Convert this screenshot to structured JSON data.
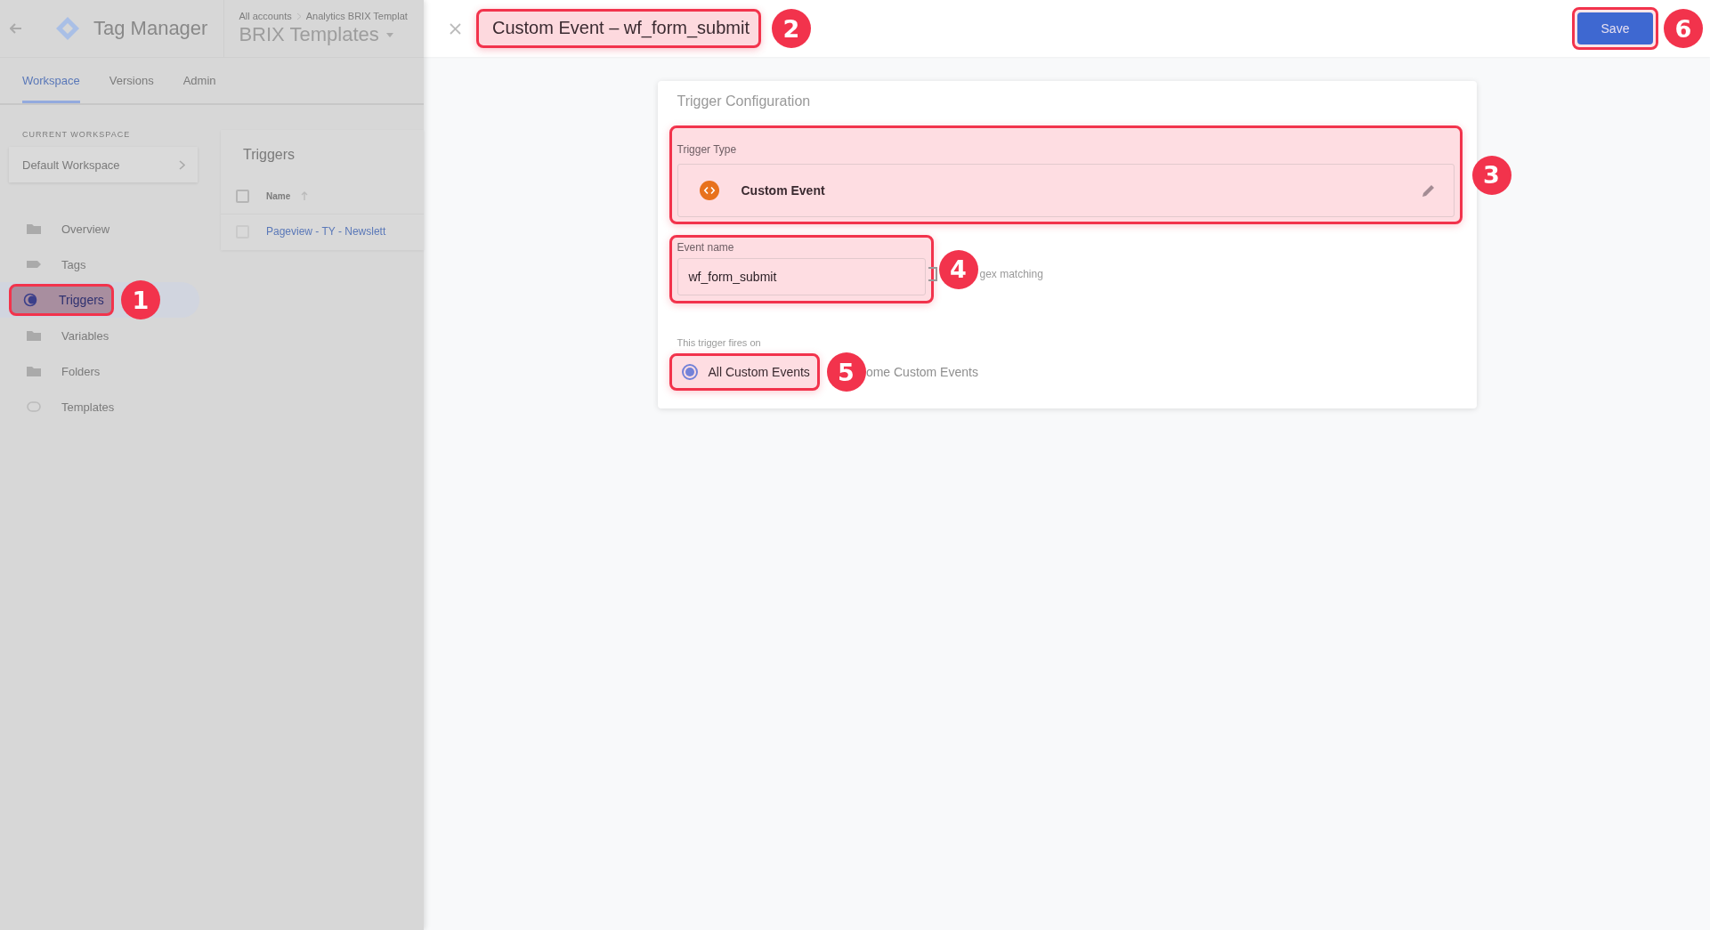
{
  "app": {
    "title": "Tag Manager",
    "breadcrumb": [
      "All accounts",
      "Analytics BRIX Templat"
    ],
    "container": "BRIX Templates"
  },
  "tabs": [
    {
      "label": "Workspace",
      "selected": true
    },
    {
      "label": "Versions",
      "selected": false
    },
    {
      "label": "Admin",
      "selected": false
    }
  ],
  "workspace": {
    "heading": "CURRENT WORKSPACE",
    "name": "Default Workspace"
  },
  "sidebar": {
    "items": [
      {
        "label": "Overview",
        "kind": "overview",
        "selected": false
      },
      {
        "label": "Tags",
        "kind": "tags",
        "selected": false
      },
      {
        "label": "Triggers",
        "kind": "triggers",
        "selected": true,
        "callout": "1"
      },
      {
        "label": "Variables",
        "kind": "variables",
        "selected": false
      },
      {
        "label": "Folders",
        "kind": "folders",
        "selected": false
      },
      {
        "label": "Templates",
        "kind": "templates",
        "selected": false
      }
    ]
  },
  "triggers_list": {
    "title": "Triggers",
    "column": "Name",
    "all_checked": false,
    "rows": [
      {
        "name": "Pageview - TY - Newslett",
        "checked": false
      }
    ]
  },
  "editor": {
    "title": "Custom Event – wf_form_submit",
    "title_callout": "2",
    "save": "Save",
    "save_callout": "6"
  },
  "config": {
    "heading": "Trigger Configuration",
    "trigger_type": {
      "label": "Trigger Type",
      "value": "Custom Event",
      "callout": "3"
    },
    "event_name": {
      "label": "Event name",
      "value": "wf_form_submit",
      "callout": "4"
    },
    "regex": {
      "label": "gex matching",
      "checked": false
    },
    "fires_on": {
      "label": "This trigger fires on",
      "options": [
        {
          "label": "All Custom Events",
          "selected": true,
          "callout": "5"
        },
        {
          "label": "ome Custom Events",
          "selected": false
        }
      ]
    }
  }
}
